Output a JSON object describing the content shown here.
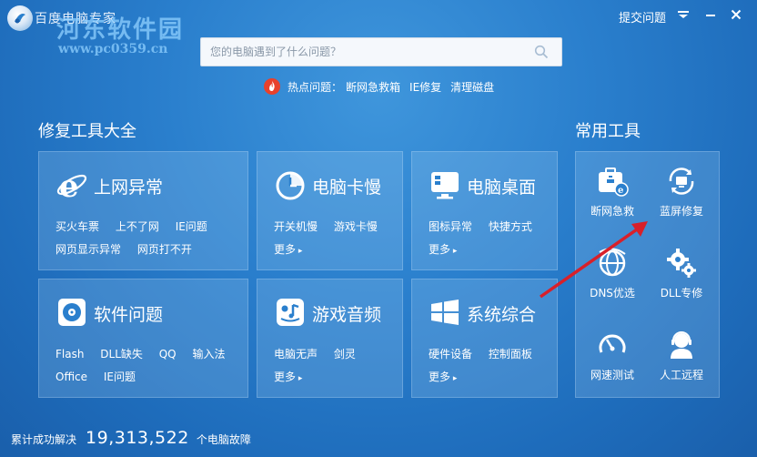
{
  "app": {
    "title": "百度电脑专家",
    "watermark_text": "河东软件园",
    "watermark_url": "www.pc0359.cn",
    "feedback": "提交问题"
  },
  "search": {
    "placeholder": "您的电脑遇到了什么问题？"
  },
  "hot": {
    "label": "热点问题：",
    "links": [
      "断网急救箱",
      "IE修复",
      "清理磁盘"
    ]
  },
  "repair": {
    "heading": "修复工具大全",
    "more_label": "更多",
    "cards": [
      {
        "title": "上网异常",
        "icon": "ie-icon",
        "rows": [
          [
            "网页显示异常"
          ],
          [
            "网页打不开"
          ]
        ],
        "row1": [
          "买火车票",
          "上不了网",
          "IE问题"
        ],
        "row2": [
          "网页显示异常",
          "网页打不开"
        ]
      },
      {
        "title": "电脑卡慢",
        "icon": "timer-icon",
        "row1": [
          "开关机慢",
          "游戏卡慢"
        ]
      },
      {
        "title": "电脑桌面",
        "icon": "desktop-icon",
        "row1": [
          "图标异常",
          "快捷方式"
        ]
      },
      {
        "title": "软件问题",
        "icon": "disc-icon",
        "row1": [
          "Flash",
          "DLL缺失",
          "QQ",
          "输入法"
        ],
        "row2": [
          "Office",
          "IE问题"
        ]
      },
      {
        "title": "游戏音频",
        "icon": "gamepad-icon",
        "row1": [
          "电脑无声",
          "剑灵"
        ]
      },
      {
        "title": "系统综合",
        "icon": "windows-icon",
        "row1": [
          "硬件设备",
          "控制面板"
        ]
      }
    ]
  },
  "tools": {
    "heading": "常用工具",
    "items": [
      "断网急救",
      "蓝屏修复",
      "DNS优选",
      "DLL专修",
      "网速测试",
      "人工远程"
    ]
  },
  "footer": {
    "prefix": "累计成功解决",
    "count": "19,313,522",
    "suffix": "个电脑故障"
  },
  "colors": {
    "background": "#2a7fcd",
    "card": "#adc4f5",
    "arrow": "#d8202a",
    "hot_icon": "#e8412c"
  }
}
